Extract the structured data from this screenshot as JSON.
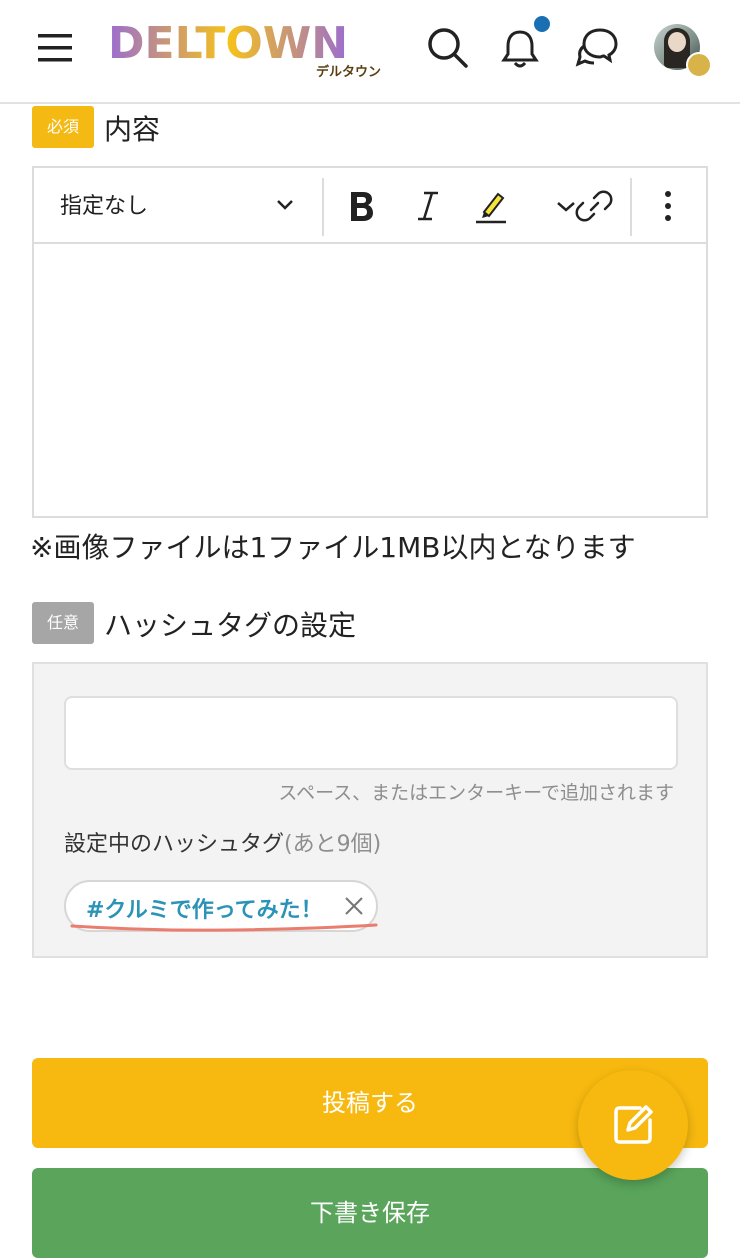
{
  "header": {
    "logo_text": "DELTOWN",
    "logo_subtitle": "デルタウン",
    "icons": [
      "menu-icon",
      "search-icon",
      "bell-icon",
      "chat-icon",
      "avatar"
    ]
  },
  "content_section": {
    "badge": "必須",
    "title": "内容",
    "format_select": "指定なし",
    "note": "※画像ファイルは1ファイル1MB以内となります"
  },
  "hashtag_section": {
    "badge": "任意",
    "title": "ハッシュタグの設定",
    "input_value": "",
    "hint": "スペース、またはエンターキーで追加されます",
    "current_label": "設定中のハッシュタグ",
    "remaining": "(あと9個)",
    "tags": [
      "#クルミで作ってみた！"
    ]
  },
  "actions": {
    "post_label": "投稿する",
    "draft_label": "下書き保存"
  },
  "colors": {
    "accent_yellow": "#f7b90f",
    "green": "#5aa55b",
    "tag_blue": "#2b93b8",
    "notif_blue": "#1a6fb3"
  }
}
